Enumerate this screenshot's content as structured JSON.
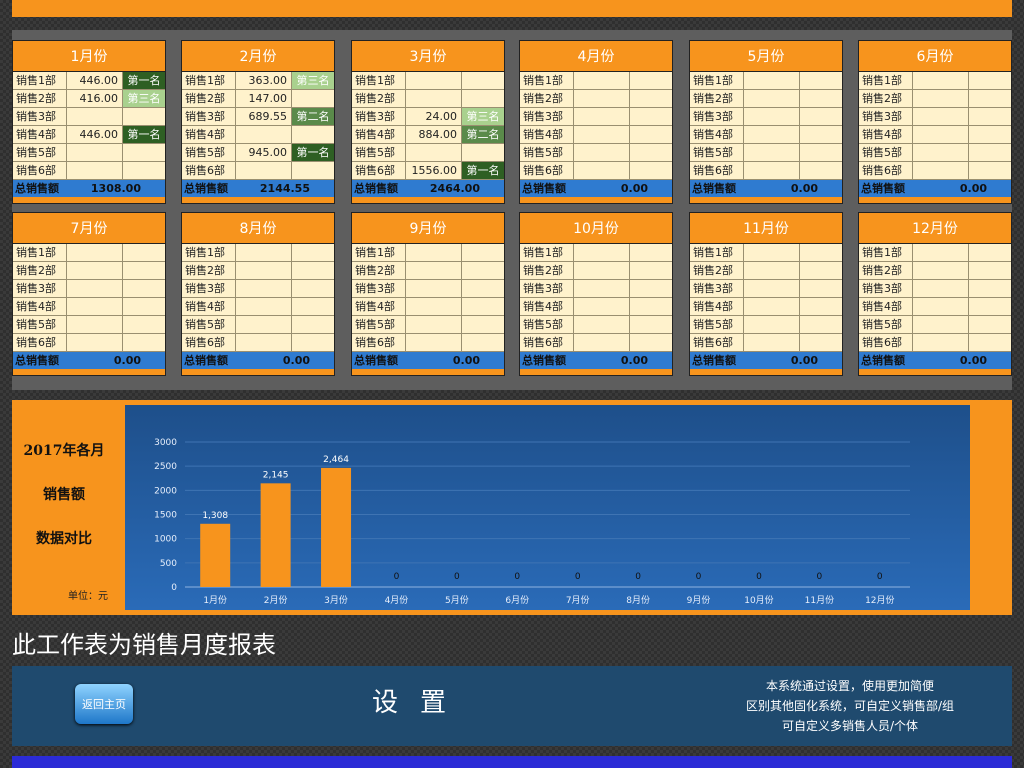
{
  "dept_label_prefix": "销售",
  "total_label": "总销售额",
  "months": [
    {
      "title": "1月份",
      "rows": [
        {
          "dept": "销售1部",
          "val": "446.00",
          "rank": "第一名",
          "rank_level": 1
        },
        {
          "dept": "销售2部",
          "val": "416.00",
          "rank": "第三名",
          "rank_level": 3
        },
        {
          "dept": "销售3部",
          "val": "",
          "rank": "",
          "rank_level": 0
        },
        {
          "dept": "销售4部",
          "val": "446.00",
          "rank": "第一名",
          "rank_level": 1
        },
        {
          "dept": "销售5部",
          "val": "",
          "rank": "",
          "rank_level": 0
        },
        {
          "dept": "销售6部",
          "val": "",
          "rank": "",
          "rank_level": 0
        }
      ],
      "total": "1308.00"
    },
    {
      "title": "2月份",
      "rows": [
        {
          "dept": "销售1部",
          "val": "363.00",
          "rank": "第三名",
          "rank_level": 3
        },
        {
          "dept": "销售2部",
          "val": "147.00",
          "rank": "",
          "rank_level": 0
        },
        {
          "dept": "销售3部",
          "val": "689.55",
          "rank": "第二名",
          "rank_level": 2
        },
        {
          "dept": "销售4部",
          "val": "",
          "rank": "",
          "rank_level": 0
        },
        {
          "dept": "销售5部",
          "val": "945.00",
          "rank": "第一名",
          "rank_level": 1
        },
        {
          "dept": "销售6部",
          "val": "",
          "rank": "",
          "rank_level": 0
        }
      ],
      "total": "2144.55"
    },
    {
      "title": "3月份",
      "rows": [
        {
          "dept": "销售1部",
          "val": "",
          "rank": "",
          "rank_level": 0
        },
        {
          "dept": "销售2部",
          "val": "",
          "rank": "",
          "rank_level": 0
        },
        {
          "dept": "销售3部",
          "val": "24.00",
          "rank": "第三名",
          "rank_level": 3
        },
        {
          "dept": "销售4部",
          "val": "884.00",
          "rank": "第二名",
          "rank_level": 2
        },
        {
          "dept": "销售5部",
          "val": "",
          "rank": "",
          "rank_level": 0
        },
        {
          "dept": "销售6部",
          "val": "1556.00",
          "rank": "第一名",
          "rank_level": 1
        }
      ],
      "total": "2464.00"
    },
    {
      "title": "4月份",
      "rows": [
        {
          "dept": "销售1部",
          "val": "",
          "rank": "",
          "rank_level": 0
        },
        {
          "dept": "销售2部",
          "val": "",
          "rank": "",
          "rank_level": 0
        },
        {
          "dept": "销售3部",
          "val": "",
          "rank": "",
          "rank_level": 0
        },
        {
          "dept": "销售4部",
          "val": "",
          "rank": "",
          "rank_level": 0
        },
        {
          "dept": "销售5部",
          "val": "",
          "rank": "",
          "rank_level": 0
        },
        {
          "dept": "销售6部",
          "val": "",
          "rank": "",
          "rank_level": 0
        }
      ],
      "total": "0.00"
    },
    {
      "title": "5月份",
      "rows": [
        {
          "dept": "销售1部",
          "val": "",
          "rank": "",
          "rank_level": 0
        },
        {
          "dept": "销售2部",
          "val": "",
          "rank": "",
          "rank_level": 0
        },
        {
          "dept": "销售3部",
          "val": "",
          "rank": "",
          "rank_level": 0
        },
        {
          "dept": "销售4部",
          "val": "",
          "rank": "",
          "rank_level": 0
        },
        {
          "dept": "销售5部",
          "val": "",
          "rank": "",
          "rank_level": 0
        },
        {
          "dept": "销售6部",
          "val": "",
          "rank": "",
          "rank_level": 0
        }
      ],
      "total": "0.00"
    },
    {
      "title": "6月份",
      "rows": [
        {
          "dept": "销售1部",
          "val": "",
          "rank": "",
          "rank_level": 0
        },
        {
          "dept": "销售2部",
          "val": "",
          "rank": "",
          "rank_level": 0
        },
        {
          "dept": "销售3部",
          "val": "",
          "rank": "",
          "rank_level": 0
        },
        {
          "dept": "销售4部",
          "val": "",
          "rank": "",
          "rank_level": 0
        },
        {
          "dept": "销售5部",
          "val": "",
          "rank": "",
          "rank_level": 0
        },
        {
          "dept": "销售6部",
          "val": "",
          "rank": "",
          "rank_level": 0
        }
      ],
      "total": "0.00"
    },
    {
      "title": "7月份",
      "rows": [
        {
          "dept": "销售1部",
          "val": "",
          "rank": "",
          "rank_level": 0
        },
        {
          "dept": "销售2部",
          "val": "",
          "rank": "",
          "rank_level": 0
        },
        {
          "dept": "销售3部",
          "val": "",
          "rank": "",
          "rank_level": 0
        },
        {
          "dept": "销售4部",
          "val": "",
          "rank": "",
          "rank_level": 0
        },
        {
          "dept": "销售5部",
          "val": "",
          "rank": "",
          "rank_level": 0
        },
        {
          "dept": "销售6部",
          "val": "",
          "rank": "",
          "rank_level": 0
        }
      ],
      "total": "0.00"
    },
    {
      "title": "8月份",
      "rows": [
        {
          "dept": "销售1部",
          "val": "",
          "rank": "",
          "rank_level": 0
        },
        {
          "dept": "销售2部",
          "val": "",
          "rank": "",
          "rank_level": 0
        },
        {
          "dept": "销售3部",
          "val": "",
          "rank": "",
          "rank_level": 0
        },
        {
          "dept": "销售4部",
          "val": "",
          "rank": "",
          "rank_level": 0
        },
        {
          "dept": "销售5部",
          "val": "",
          "rank": "",
          "rank_level": 0
        },
        {
          "dept": "销售6部",
          "val": "",
          "rank": "",
          "rank_level": 0
        }
      ],
      "total": "0.00"
    },
    {
      "title": "9月份",
      "rows": [
        {
          "dept": "销售1部",
          "val": "",
          "rank": "",
          "rank_level": 0
        },
        {
          "dept": "销售2部",
          "val": "",
          "rank": "",
          "rank_level": 0
        },
        {
          "dept": "销售3部",
          "val": "",
          "rank": "",
          "rank_level": 0
        },
        {
          "dept": "销售4部",
          "val": "",
          "rank": "",
          "rank_level": 0
        },
        {
          "dept": "销售5部",
          "val": "",
          "rank": "",
          "rank_level": 0
        },
        {
          "dept": "销售6部",
          "val": "",
          "rank": "",
          "rank_level": 0
        }
      ],
      "total": "0.00"
    },
    {
      "title": "10月份",
      "rows": [
        {
          "dept": "销售1部",
          "val": "",
          "rank": "",
          "rank_level": 0
        },
        {
          "dept": "销售2部",
          "val": "",
          "rank": "",
          "rank_level": 0
        },
        {
          "dept": "销售3部",
          "val": "",
          "rank": "",
          "rank_level": 0
        },
        {
          "dept": "销售4部",
          "val": "",
          "rank": "",
          "rank_level": 0
        },
        {
          "dept": "销售5部",
          "val": "",
          "rank": "",
          "rank_level": 0
        },
        {
          "dept": "销售6部",
          "val": "",
          "rank": "",
          "rank_level": 0
        }
      ],
      "total": "0.00"
    },
    {
      "title": "11月份",
      "rows": [
        {
          "dept": "销售1部",
          "val": "",
          "rank": "",
          "rank_level": 0
        },
        {
          "dept": "销售2部",
          "val": "",
          "rank": "",
          "rank_level": 0
        },
        {
          "dept": "销售3部",
          "val": "",
          "rank": "",
          "rank_level": 0
        },
        {
          "dept": "销售4部",
          "val": "",
          "rank": "",
          "rank_level": 0
        },
        {
          "dept": "销售5部",
          "val": "",
          "rank": "",
          "rank_level": 0
        },
        {
          "dept": "销售6部",
          "val": "",
          "rank": "",
          "rank_level": 0
        }
      ],
      "total": "0.00"
    },
    {
      "title": "12月份",
      "rows": [
        {
          "dept": "销售1部",
          "val": "",
          "rank": "",
          "rank_level": 0
        },
        {
          "dept": "销售2部",
          "val": "",
          "rank": "",
          "rank_level": 0
        },
        {
          "dept": "销售3部",
          "val": "",
          "rank": "",
          "rank_level": 0
        },
        {
          "dept": "销售4部",
          "val": "",
          "rank": "",
          "rank_level": 0
        },
        {
          "dept": "销售5部",
          "val": "",
          "rank": "",
          "rank_level": 0
        },
        {
          "dept": "销售6部",
          "val": "",
          "rank": "",
          "rank_level": 0
        }
      ],
      "total": "0.00"
    }
  ],
  "chart_side": {
    "line1": "2017年各月",
    "line2": "销售额",
    "line3": "数据对比",
    "unit": "单位：元"
  },
  "chart_data": {
    "type": "bar",
    "categories": [
      "1月份",
      "2月份",
      "3月份",
      "4月份",
      "5月份",
      "6月份",
      "7月份",
      "8月份",
      "9月份",
      "10月份",
      "11月份",
      "12月份"
    ],
    "values": [
      1308,
      2145,
      2464,
      0,
      0,
      0,
      0,
      0,
      0,
      0,
      0,
      0
    ],
    "data_labels": [
      "1,308",
      "2,145",
      "2,464",
      "0",
      "0",
      "0",
      "0",
      "0",
      "0",
      "0",
      "0",
      "0"
    ],
    "y_ticks": [
      "0",
      "500",
      "1000",
      "1500",
      "2000",
      "2500",
      "3000"
    ],
    "ylim": [
      0,
      3000
    ],
    "bar_color": "#f7941d",
    "grid": true
  },
  "caption": "此工作表为销售月度报表",
  "settings": {
    "home_button": "返回主页",
    "title": "设置",
    "desc1": "本系统通过设置，使用更加简便",
    "desc2": "区别其他固化系统，可自定义销售部/组",
    "desc3": "可自定义多销售人员/个体"
  },
  "colors": {
    "accent": "#f7941d",
    "blue": "#2f7bd0",
    "rank1": "#2e5f23",
    "rank2": "#5a8a4a",
    "rank3": "#a9d18e"
  }
}
